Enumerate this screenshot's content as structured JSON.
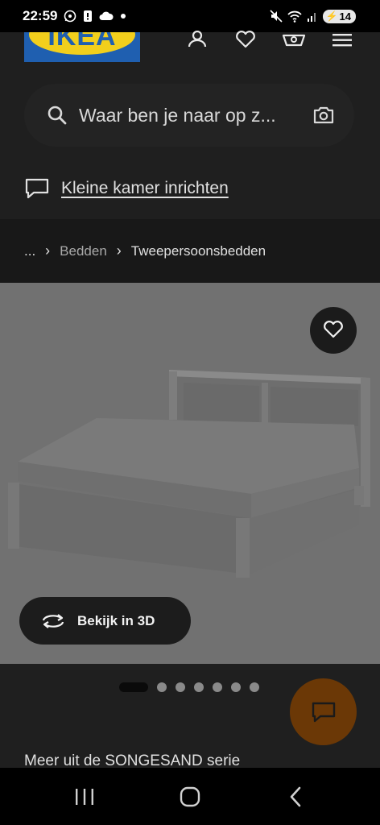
{
  "status_bar": {
    "time": "22:59",
    "battery": "14",
    "icons": [
      "whatsapp-icon",
      "notification-icon",
      "cloud-icon",
      "dot-icon",
      "mute-icon",
      "wifi-icon",
      "signal-icon",
      "battery-icon"
    ]
  },
  "header": {
    "logo_text": "IKEA",
    "icons": [
      "user-icon",
      "heart-icon",
      "basket-icon",
      "menu-icon"
    ]
  },
  "search": {
    "placeholder": "Waar ben je naar op z..."
  },
  "room_link": {
    "label": "Kleine kamer inrichten"
  },
  "breadcrumb": {
    "ellipsis": "...",
    "items": [
      "Bedden",
      "Tweepersoonsbedden"
    ]
  },
  "product_image": {
    "view_3d_label": "Bekijk in 3D"
  },
  "carousel": {
    "total": 7,
    "active_index": 0
  },
  "more_series": {
    "text": "Meer uit de SONGESAND serie"
  },
  "colors": {
    "logo_blue": "#1f5fb0",
    "logo_yellow": "#f2cf1c",
    "chat_button": "#6b3806"
  }
}
